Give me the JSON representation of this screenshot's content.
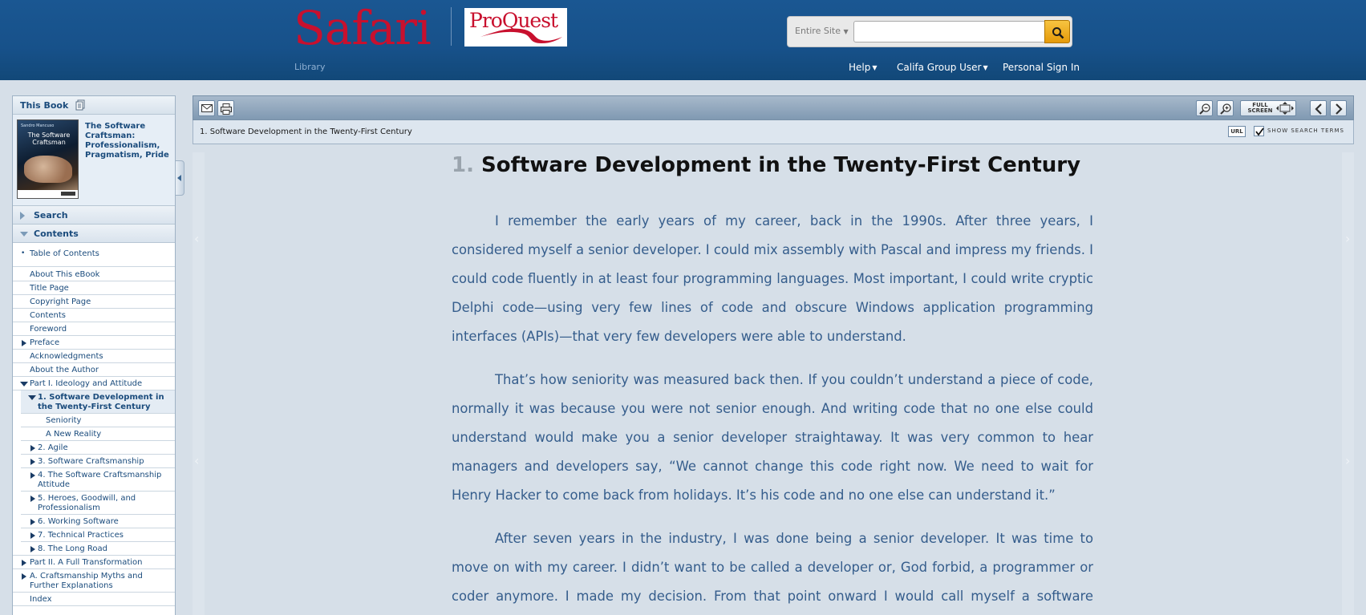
{
  "header": {
    "safari_logo": "Safari",
    "proquest_logo": "ProQuest",
    "library_label": "Library",
    "search_scope": "Entire Site",
    "search_value": "",
    "nav": {
      "help": "Help",
      "group_user": "Califa Group User",
      "sign_in": "Personal Sign In"
    }
  },
  "sidebar": {
    "this_book_label": "This Book",
    "book_title": "The Software Craftsman: Professionalism, Pragmatism, Pride",
    "cover": {
      "author": "Sandro Mancuso",
      "title": "The Software Craftsman"
    },
    "search_label": "Search",
    "contents_label": "Contents",
    "toc": {
      "table_of_contents": "Table of Contents",
      "about_ebook": "About This eBook",
      "title_page": "Title Page",
      "copyright_page": "Copyright Page",
      "contents": "Contents",
      "foreword": "Foreword",
      "preface": "Preface",
      "acknowledgments": "Acknowledgments",
      "about_author": "About the Author",
      "part1": "Part I. Ideology and Attitude",
      "ch1": "1. Software Development in the Twenty-First Century",
      "seniority": "Seniority",
      "new_reality": "A New Reality",
      "ch2": "2. Agile",
      "ch3": "3. Software Craftsmanship",
      "ch4": "4. The Software Craftsmanship Attitude",
      "ch5": "5. Heroes, Goodwill, and Professionalism",
      "ch6": "6. Working Software",
      "ch7": "7. Technical Practices",
      "ch8": "8. The Long Road",
      "part2": "Part II. A Full Transformation",
      "appA": "A. Craftsmanship Myths and Further Explanations",
      "index": "Index"
    }
  },
  "reader": {
    "breadcrumb": "1. Software Development in the Twenty-First Century",
    "full_screen": "FULL SCREEN",
    "url_label": "URL",
    "show_search_terms": "Show search terms",
    "chapter_number": "1.",
    "chapter_title": "Software Development in the Twenty-First Century",
    "paragraphs": [
      "I remember the early years of my career, back in the 1990s. After three years, I considered myself a senior developer. I could mix assembly with Pascal and impress my friends. I could code fluently in at least four programming languages. Most important, I could write cryptic Delphi code—using very few lines of code and obscure Windows application programming interfaces (APIs)—that very few developers were able to understand.",
      "That’s how seniority was measured back then. If you couldn’t understand a piece of code, normally it was because you were not senior enough. And writing code that no one else could understand would make you a senior developer straightaway. It was very common to hear managers and developers say, “We cannot change this code right now. We need to wait for Henry Hacker to come back from holidays. It’s his code and no one else can understand it.”",
      "After seven years in the industry, I was done being a senior developer. It was time to move on with my career. I didn’t want to be called a developer or, God forbid, a programmer or coder anymore. I made my decision. From that point onward I would call myself a software architect. Why"
    ]
  },
  "colors": {
    "header_blue": "#17518a",
    "safari_red": "#c8102e",
    "link_blue": "#1a4b7c",
    "body_text": "#355d8c"
  }
}
